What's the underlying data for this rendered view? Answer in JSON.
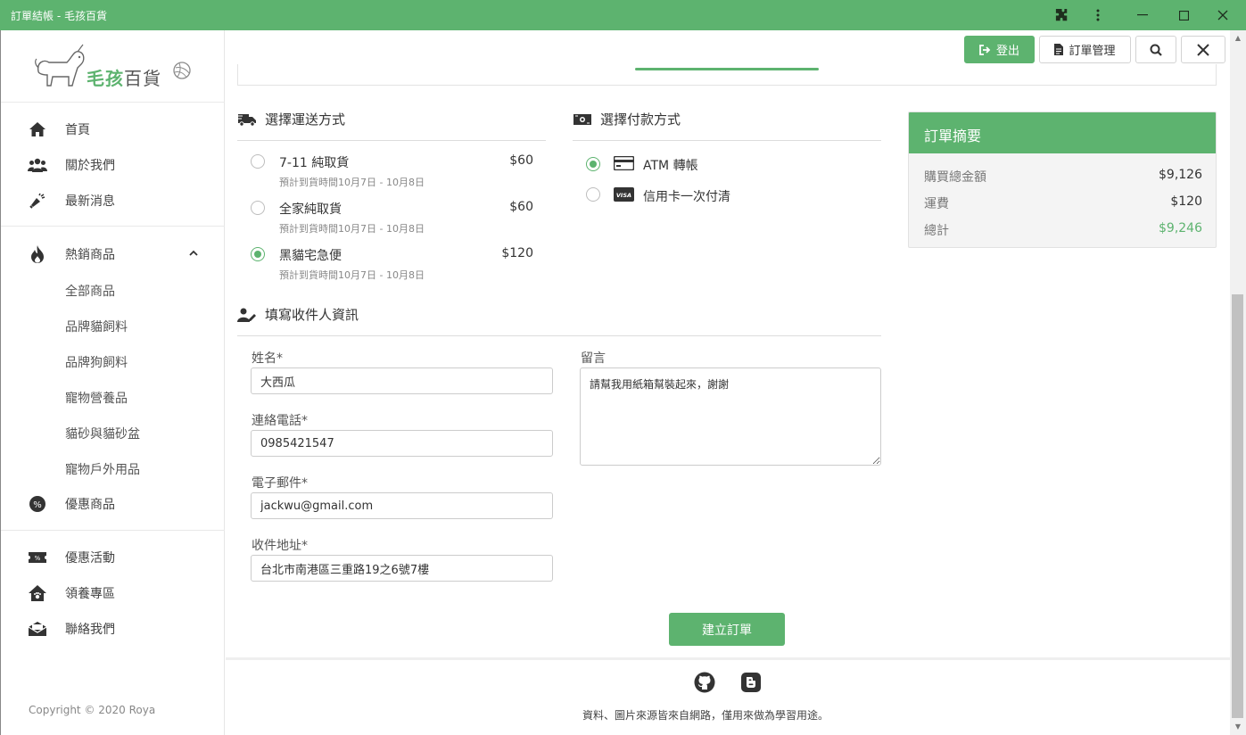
{
  "window": {
    "title": "訂單結帳 - 毛孩百貨"
  },
  "logo": {
    "text_main": "毛孩",
    "text_sub": "百貨"
  },
  "sidebar": {
    "items": [
      {
        "label": "首頁"
      },
      {
        "label": "關於我們"
      },
      {
        "label": "最新消息"
      },
      {
        "label": "熱銷商品"
      },
      {
        "label": "優惠商品"
      },
      {
        "label": "優惠活動"
      },
      {
        "label": "領養專區"
      },
      {
        "label": "聯絡我們"
      }
    ],
    "subitems": [
      "全部商品",
      "品牌貓飼料",
      "品牌狗飼料",
      "寵物營養品",
      "貓砂與貓砂盆",
      "寵物戶外用品"
    ],
    "copyright": "Copyright © 2020 Roya"
  },
  "toolbar": {
    "logout_label": "登出",
    "orders_label": "訂單管理"
  },
  "shipping": {
    "title": "選擇運送方式",
    "options": [
      {
        "name": "7-11 純取貨",
        "price": "$60",
        "eta": "預計到貨時間10月7日 - 10月8日",
        "selected": false
      },
      {
        "name": "全家純取貨",
        "price": "$60",
        "eta": "預計到貨時間10月7日 - 10月8日",
        "selected": false
      },
      {
        "name": "黑貓宅急便",
        "price": "$120",
        "eta": "預計到貨時間10月7日 - 10月8日",
        "selected": true
      }
    ]
  },
  "payment": {
    "title": "選擇付款方式",
    "options": [
      {
        "label": "ATM 轉帳",
        "icon": "credit-card-icon",
        "selected": true
      },
      {
        "label": "信用卡一次付清",
        "icon": "visa-icon",
        "selected": false
      }
    ]
  },
  "summary": {
    "title": "訂單摘要",
    "rows": [
      {
        "label": "購買總金額",
        "value": "$9,126"
      },
      {
        "label": "運費",
        "value": "$120"
      },
      {
        "label": "總計",
        "value": "$9,246"
      }
    ]
  },
  "recipient": {
    "title": "填寫收件人資訊",
    "name_label": "姓名*",
    "name_value": "大西瓜",
    "phone_label": "連絡電話*",
    "phone_value": "0985421547",
    "email_label": "電子郵件*",
    "email_value": "jackwu@gmail.com",
    "address_label": "收件地址*",
    "address_value": "台北市南港區三重路19之6號7樓",
    "message_label": "留言",
    "message_value": "請幫我用紙箱幫裝起來，謝謝"
  },
  "submit_label": "建立訂單",
  "footer": {
    "note": "資料、圖片來源皆來自網路，僅用來做為學習用途。"
  },
  "colors": {
    "accent": "#5db36f"
  }
}
